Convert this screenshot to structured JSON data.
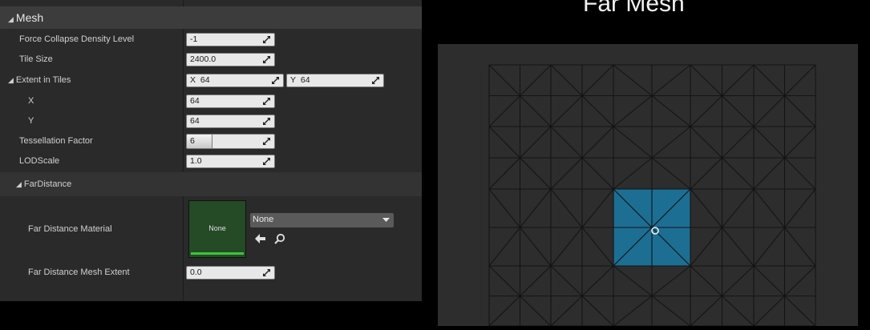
{
  "details": {
    "mesh_category": "Mesh",
    "rows": {
      "force_collapse": {
        "label": "Force Collapse Density Level",
        "value": "-1"
      },
      "tile_size": {
        "label": "Tile Size",
        "value": "2400.0"
      },
      "extent": {
        "label": "Extent in Tiles",
        "x_prefix": "X",
        "x_value": "64",
        "y_prefix": "Y",
        "y_value": "64"
      },
      "extent_x": {
        "label": "X",
        "value": "64"
      },
      "extent_y": {
        "label": "Y",
        "value": "64"
      },
      "tessellation": {
        "label": "Tessellation Factor",
        "value": "6",
        "slider_fraction": 0.28
      },
      "lodscale": {
        "label": "LODScale",
        "value": "1.0"
      }
    },
    "far_distance": {
      "category": "FarDistance",
      "material_label": "Far Distance Material",
      "material_thumb": "None",
      "material_dropdown": "None",
      "mesh_extent_label": "Far Distance Mesh Extent",
      "mesh_extent_value": "0.0"
    }
  },
  "preview": {
    "title": "Far Mesh",
    "tile_color": "#1c6e93",
    "grid_color": "#141414"
  },
  "icons": [
    "spinner-arrows-icon",
    "dropdown-chevron-icon",
    "use-selected-arrow-icon",
    "browse-search-icon",
    "center-point-icon"
  ]
}
